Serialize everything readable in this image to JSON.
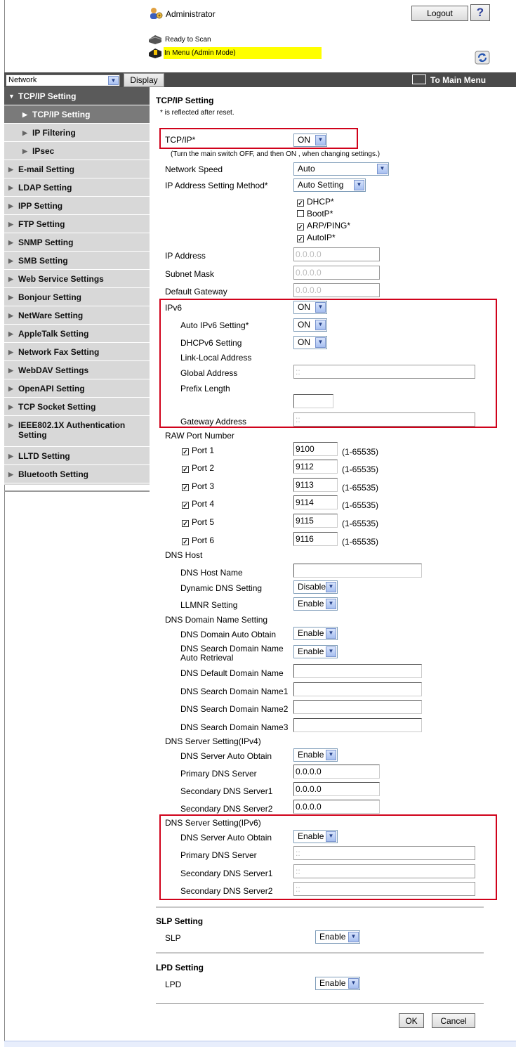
{
  "header": {
    "user_label": "Administrator",
    "logout_label": "Logout",
    "help_label": "?",
    "status_ready": "Ready to Scan",
    "status_menu": "In Menu (Admin Mode)"
  },
  "navbar": {
    "category_select": "Network",
    "display_label": "Display",
    "main_menu_label": "To Main Menu"
  },
  "sidebar": {
    "items": [
      {
        "label": "TCP/IP Setting"
      },
      {
        "label": "TCP/IP Setting"
      },
      {
        "label": "IP Filtering"
      },
      {
        "label": "IPsec"
      },
      {
        "label": "E-mail Setting"
      },
      {
        "label": "LDAP Setting"
      },
      {
        "label": "IPP Setting"
      },
      {
        "label": "FTP Setting"
      },
      {
        "label": "SNMP Setting"
      },
      {
        "label": "SMB Setting"
      },
      {
        "label": "Web Service Settings"
      },
      {
        "label": "Bonjour Setting"
      },
      {
        "label": "NetWare Setting"
      },
      {
        "label": "AppleTalk Setting"
      },
      {
        "label": "Network Fax Setting"
      },
      {
        "label": "WebDAV Settings"
      },
      {
        "label": "OpenAPI Setting"
      },
      {
        "label": "TCP Socket Setting"
      },
      {
        "label": "IEEE802.1X Authentication Setting"
      },
      {
        "label": "LLTD Setting"
      },
      {
        "label": "Bluetooth Setting"
      }
    ]
  },
  "form": {
    "title": "TCP/IP Setting",
    "note": "* is reflected after reset.",
    "tcpip_label": "TCP/IP*",
    "tcpip_value": "ON",
    "tcpip_note": "(Turn the main switch OFF, and then ON , when changing settings.)",
    "network_speed_label": "Network Speed",
    "network_speed_value": "Auto",
    "ip_method_label": "IP Address Setting Method*",
    "ip_method_value": "Auto Setting",
    "dhcp_label": "DHCP*",
    "bootp_label": "BootP*",
    "arp_label": "ARP/PING*",
    "autoip_label": "AutoIP*",
    "ip_address_label": "IP Address",
    "ip_address_value": "0.0.0.0",
    "subnet_label": "Subnet Mask",
    "subnet_value": "0.0.0.0",
    "gateway_label": "Default Gateway",
    "gateway_value": "0.0.0.0",
    "ipv6_label": "IPv6",
    "ipv6_value": "ON",
    "auto_ipv6_label": "Auto IPv6 Setting*",
    "auto_ipv6_value": "ON",
    "dhcpv6_label": "DHCPv6 Setting",
    "dhcpv6_value": "ON",
    "link_local_label": "Link-Local Address",
    "global_label": "Global Address",
    "global_value": "::",
    "prefix_label": "Prefix Length",
    "prefix_value": "",
    "ipv6_gateway_label": "Gateway Address",
    "ipv6_gateway_value": "::",
    "raw_port_label": "RAW Port Number",
    "ports": [
      {
        "label": "Port 1",
        "value": "9100",
        "range": "(1-65535)"
      },
      {
        "label": "Port 2",
        "value": "9112",
        "range": "(1-65535)"
      },
      {
        "label": "Port 3",
        "value": "9113",
        "range": "(1-65535)"
      },
      {
        "label": "Port 4",
        "value": "9114",
        "range": "(1-65535)"
      },
      {
        "label": "Port 5",
        "value": "9115",
        "range": "(1-65535)"
      },
      {
        "label": "Port 6",
        "value": "9116",
        "range": "(1-65535)"
      }
    ],
    "dns_host_label": "DNS Host",
    "dns_host_name_label": "DNS Host Name",
    "dns_host_name_value": "",
    "dynamic_dns_label": "Dynamic DNS Setting",
    "dynamic_dns_value": "Disable",
    "llmnr_label": "LLMNR Setting",
    "llmnr_value": "Enable",
    "dns_domain_label": "DNS Domain Name Setting",
    "dns_domain_auto_label": "DNS Domain Auto Obtain",
    "dns_domain_auto_value": "Enable",
    "dns_search_auto_label_1": "DNS Search Domain Name",
    "dns_search_auto_label_2": "Auto Retrieval",
    "dns_search_auto_value": "Enable",
    "dns_default_domain_label": "DNS Default Domain Name",
    "dns_search1_label": "DNS Search Domain Name1",
    "dns_search2_label": "DNS Search Domain Name2",
    "dns_search3_label": "DNS Search Domain Name3",
    "dns_v4_label": "DNS Server Setting(IPv4)",
    "dns_v4_auto_label": "DNS Server Auto Obtain",
    "dns_v4_auto_value": "Enable",
    "dns_v4_primary_label": "Primary DNS Server",
    "dns_v4_primary_value": "0.0.0.0",
    "dns_v4_sec1_label": "Secondary DNS Server1",
    "dns_v4_sec1_value": "0.0.0.0",
    "dns_v4_sec2_label": "Secondary DNS Server2",
    "dns_v4_sec2_value": "0.0.0.0",
    "dns_v6_label": "DNS Server Setting(IPv6)",
    "dns_v6_auto_label": "DNS Server Auto Obtain",
    "dns_v6_auto_value": "Enable",
    "dns_v6_primary_label": "Primary DNS Server",
    "dns_v6_primary_value": "::",
    "dns_v6_sec1_label": "Secondary DNS Server1",
    "dns_v6_sec1_value": "::",
    "dns_v6_sec2_label": "Secondary DNS Server2",
    "dns_v6_sec2_value": "::",
    "slp_title": "SLP Setting",
    "slp_label": "SLP",
    "slp_value": "Enable",
    "lpd_title": "LPD Setting",
    "lpd_label": "LPD",
    "lpd_value": "Enable",
    "ok_label": "OK",
    "cancel_label": "Cancel"
  },
  "colors": {
    "highlight_box": "#d0021b",
    "menu_highlight": "#ffff00",
    "navbar": "#4a4a4a",
    "sidebar": "#d8d8d8"
  }
}
